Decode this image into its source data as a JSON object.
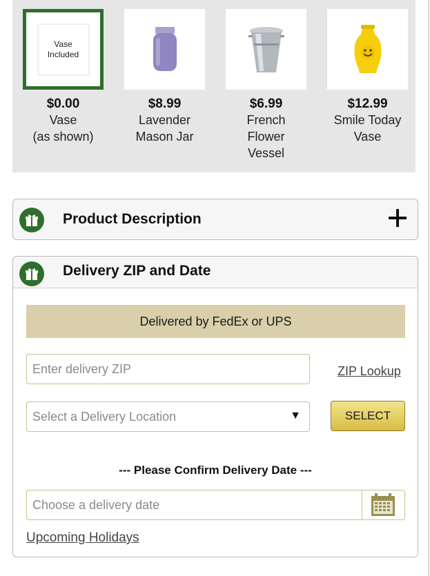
{
  "vases": [
    {
      "price": "$0.00",
      "name": "Vase\n(as shown)",
      "thumb_text": "Vase\nIncluded",
      "selected": true
    },
    {
      "price": "$8.99",
      "name": "Lavender\nMason Jar",
      "icon": "mason-jar-icon"
    },
    {
      "price": "$6.99",
      "name": "French\nFlower\nVessel",
      "icon": "flower-vessel-icon"
    },
    {
      "price": "$12.99",
      "name": "Smile Today\nVase",
      "icon": "smile-vase-icon"
    }
  ],
  "product_description": {
    "title": "Product Description",
    "icon": "gift-icon",
    "toggle_icon": "plus-icon"
  },
  "delivery": {
    "title": "Delivery ZIP and Date",
    "icon": "gift-icon",
    "carrier_banner": "Delivered by FedEx or UPS",
    "zip_placeholder": "Enter delivery ZIP",
    "zip_lookup": "ZIP Lookup",
    "location_placeholder": "Select a Delivery Location",
    "select_arrow": "▼",
    "select_button": "SELECT",
    "confirm_text": "--- Please Confirm Delivery Date ---",
    "date_placeholder": "Choose a delivery date",
    "holidays_link": "Upcoming Holidays"
  },
  "colors": {
    "accent_green": "#2f6e2c",
    "banner_tan": "#d9cfab",
    "button_gold": "#e3cd5e",
    "field_border": "#cbc08b"
  }
}
